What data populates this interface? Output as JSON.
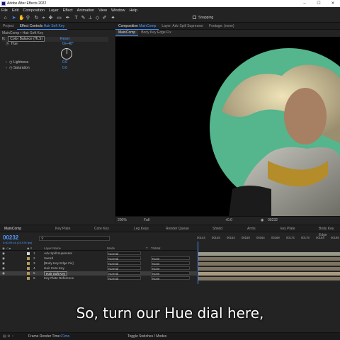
{
  "titlebar": {
    "title": "Adobe After Effects 2022",
    "minimize": "–",
    "maximize": "☐",
    "close": "✕"
  },
  "menu": [
    "File",
    "Edit",
    "Composition",
    "Layer",
    "Effect",
    "Animation",
    "View",
    "Window",
    "Help"
  ],
  "toolbar": {
    "snapping_label": "Snapping"
  },
  "project_panel": {
    "tab": "Project"
  },
  "effect_controls": {
    "tab_prefix": "Effect Controls",
    "tab_layer": "Hair Soft Key",
    "breadcrumb": "MainComp • Hair Soft Key",
    "fx_label": "fx",
    "effect_name": "Color Balance (HLS)",
    "reset": "Reset",
    "hue_label": "Hue",
    "hue_value": "0x+48°",
    "lightness_label": "Lightness",
    "lightness_value": "0.0",
    "saturation_label": "Saturation",
    "saturation_value": "0.0"
  },
  "composition_panel": {
    "tab_prefix": "Composition",
    "tab_comp": "MainComp",
    "layer_tab": "Layer: Adv Spill Supressor",
    "footage_tab": "Footage: (none)",
    "subtabs": [
      "MainComp",
      "Body Key Edge Fix"
    ]
  },
  "viewer_bar": {
    "zoom": "200%",
    "resolution": "Full",
    "exposure": "+0.0",
    "timecode": "00232"
  },
  "timeline": {
    "tabs": [
      "MainComp",
      "Key Plate",
      "Core Key",
      "Leg Keys",
      "Render Queue",
      "Shield",
      "Arms",
      "key Plate",
      "Body Key Edge"
    ],
    "timecode": "00232",
    "fps": "0:00:09:16 (23.976 fps)",
    "search_placeholder": "",
    "col_layer_name": "Layer Name",
    "col_mode": "Mode",
    "col_t": "T",
    "col_trkmat": "TrkMat",
    "ruler": [
      "00144",
      "00148",
      "00154",
      "00159",
      "00164",
      "00169",
      "00174",
      "00179",
      "00184",
      "00189"
    ],
    "layers": [
      {
        "num": "1",
        "name": "Adv Spill Supressor",
        "mode": "Normal",
        "trkmat": "",
        "color": "#d6d6d6"
      },
      {
        "num": "2",
        "name": "Sword",
        "mode": "Normal",
        "trkmat": "None",
        "color": "#b59a5a"
      },
      {
        "num": "3",
        "name": "[Body Key Edge Fix]",
        "mode": "Normal",
        "trkmat": "None",
        "color": "#b59a5a"
      },
      {
        "num": "4",
        "name": "Hair Core Key",
        "mode": "Normal",
        "trkmat": "None",
        "color": "#b59a5a"
      },
      {
        "num": "5",
        "name": "Hair Soft Key",
        "mode": "Normal",
        "trkmat": "None",
        "color": "#b59a5a"
      },
      {
        "num": "6",
        "name": "Key Plate Reference",
        "mode": "Normal",
        "trkmat": "None",
        "color": "#b59a5a"
      }
    ]
  },
  "status": {
    "render_label": "Frame Render Time:",
    "render_value": "21ms",
    "toggle": "Toggle Switches / Modes"
  },
  "caption": "So, turn our Hue dial here,"
}
